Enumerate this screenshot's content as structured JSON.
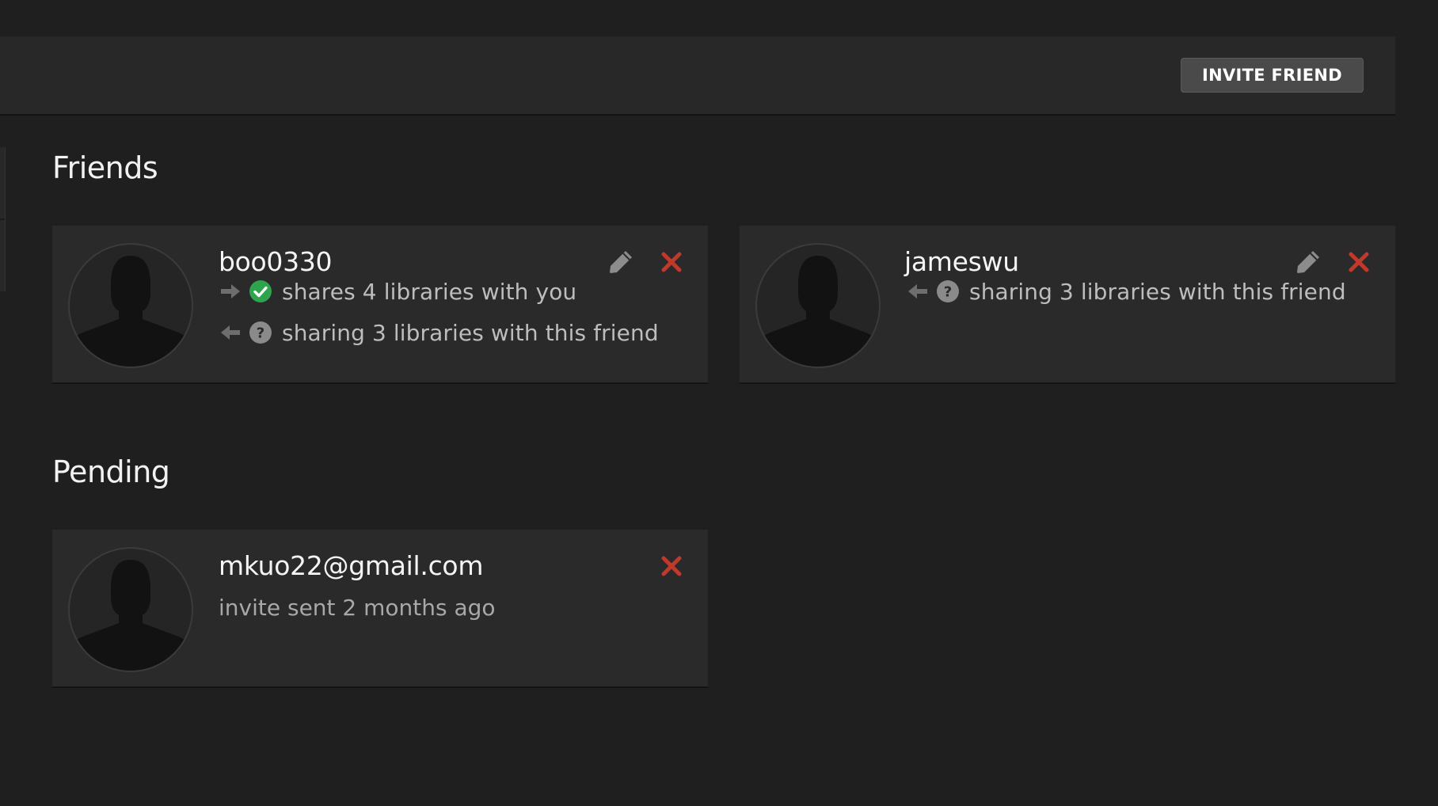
{
  "header": {
    "invite_button": "INVITE FRIEND"
  },
  "sections": {
    "friends_title": "Friends",
    "pending_title": "Pending"
  },
  "friends": [
    {
      "name": "boo0330",
      "incoming": {
        "icon": "check-circle-icon",
        "text": "shares 4 libraries with you"
      },
      "outgoing": {
        "icon": "question-circle-icon",
        "text": "sharing 3 libraries with this friend"
      }
    },
    {
      "name": "jameswu",
      "outgoing": {
        "icon": "question-circle-icon",
        "text": "sharing 3 libraries with this friend"
      }
    }
  ],
  "pending": [
    {
      "email": "mkuo22@gmail.com",
      "status": "invite sent 2 months ago"
    }
  ],
  "colors": {
    "background": "#1f1f1f",
    "card": "#2a2a2a",
    "remove": "#c0392b",
    "check": "#2ea44f",
    "muted_icon": "#8a8a8a"
  }
}
